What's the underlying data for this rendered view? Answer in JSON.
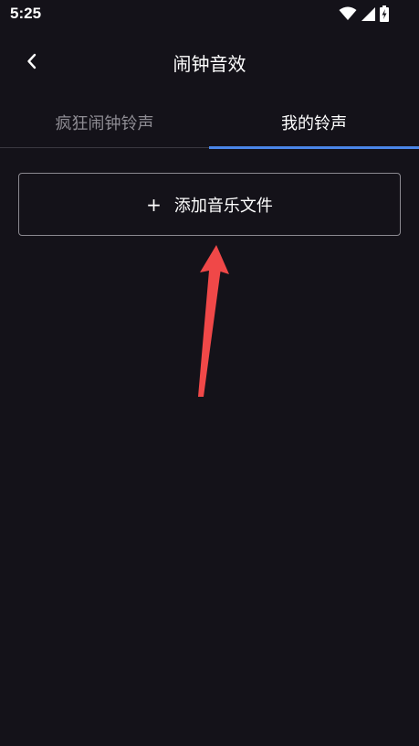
{
  "status_bar": {
    "time": "5:25",
    "icons": [
      "wifi-icon",
      "cellular-signal-icon",
      "battery-charging-icon"
    ]
  },
  "app_bar": {
    "back_icon": "chevron-left-icon",
    "title": "闹钟音效"
  },
  "tabs": [
    {
      "label": "疯狂闹钟铃声",
      "selected": false
    },
    {
      "label": "我的铃声",
      "selected": true
    }
  ],
  "add_button": {
    "icon": "+",
    "label": "添加音乐文件"
  },
  "colors": {
    "background": "#141219",
    "tab_indicator": "#4a86e8",
    "inactive_tab_text": "#8e8c93",
    "annotation_arrow": "#f04848"
  }
}
